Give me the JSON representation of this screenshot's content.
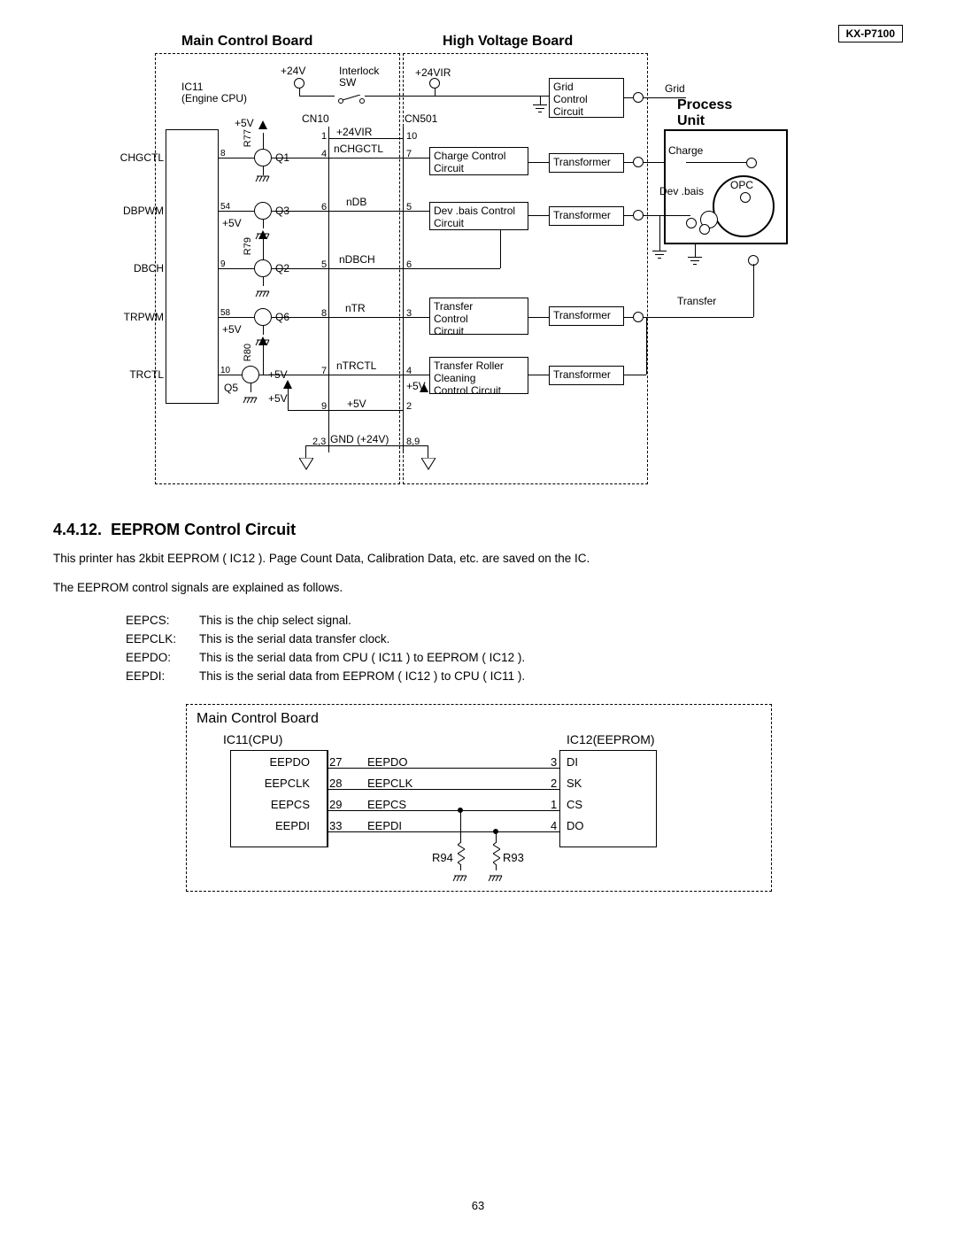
{
  "model": "KX-P7100",
  "diagram": {
    "mainTitle": "Main Control Board",
    "hvTitle": "High Voltage Board",
    "procTitle": "Process\nUnit",
    "ic": "IC11\n(Engine CPU)",
    "p5v_a": "+5V",
    "p5v_b": "+5V",
    "p5v_c": "+5V",
    "p5v_d": "+5V",
    "p5v_e": "+5V",
    "p5v_f": "+5V",
    "p24v": "+24V",
    "interlock": "Interlock\nSW",
    "p24vir": "+24VIR",
    "r77": "R77",
    "r79": "R79",
    "r80": "R80",
    "cn10": "CN10",
    "cn501": "CN501",
    "signals": {
      "CHGCTL": "CHGCTL",
      "DBPWM": "DBPWM",
      "DBCH": "DBCH",
      "TRPWM": "TRPWM",
      "TRCTL": "TRCTL"
    },
    "pinsL": {
      "CHGCTL": "8",
      "DBPWM": "54",
      "DBCH": "9",
      "TRPWM": "58",
      "TRCTL": "10"
    },
    "q": {
      "Q1": "Q1",
      "Q2": "Q2",
      "Q3": "Q3",
      "Q5": "Q5",
      "Q6": "Q6"
    },
    "netnames": {
      "p24vir_b": "+24VIR",
      "nCHGCTL": "nCHGCTL",
      "nDB": "nDB",
      "nDBCH": "nDBCH",
      "nTR": "nTR",
      "nTRCTL": "nTRCTL",
      "p5v_net": "+5V",
      "gnd24": "GND (+24V)"
    },
    "cn10pins": {
      "a": "1",
      "b": "4",
      "c": "6",
      "d": "5",
      "e": "8",
      "f": "7",
      "g": "9",
      "h": "2,3"
    },
    "cn501pins": {
      "a": "10",
      "b": "7",
      "c": "5",
      "d": "6",
      "e": "3",
      "f": "4",
      "g": "2",
      "h": "8,9"
    },
    "blocks": {
      "grid": "Grid\nControl\nCircuit",
      "charge": "Charge Control\nCircuit",
      "dev": "Dev .bais Control\nCircuit",
      "trf": "Transfer\nControl\nCircuit",
      "trRoller": "Transfer Roller\nCleaning\nControl Circuit",
      "xfmr": "Transformer"
    },
    "proc": {
      "grid": "Grid",
      "charge": "Charge",
      "devbais": "Dev .bais",
      "opc": "OPC",
      "transfer": "Transfer"
    }
  },
  "section": {
    "num": "4.4.12.",
    "title": "EEPROM Control Circuit",
    "intro": "This printer has 2kbit EEPROM ( IC12 ). Page Count Data, Calibration Data, etc. are saved on the IC.",
    "lead": "The EEPROM control signals are explained as follows.",
    "rows": [
      {
        "k": "EEPCS:",
        "v": "This is the chip select signal."
      },
      {
        "k": "EEPCLK:",
        "v": "This is the serial data transfer clock."
      },
      {
        "k": "EEPDO:",
        "v": "This is the serial data from CPU ( IC11 ) to EEPROM ( IC12 )."
      },
      {
        "k": "EEPDI:",
        "v": "This is the serial data from EEPROM ( IC12 ) to CPU ( IC11 )."
      }
    ]
  },
  "eeprom": {
    "board": "Main Control Board",
    "ic11": "IC11(CPU)",
    "ic12": "IC12(EEPROM)",
    "left": [
      {
        "name": "EEPDO",
        "pin": "27"
      },
      {
        "name": "EEPCLK",
        "pin": "28"
      },
      {
        "name": "EEPCS",
        "pin": "29"
      },
      {
        "name": "EEPDI",
        "pin": "33"
      }
    ],
    "nets": [
      "EEPDO",
      "EEPCLK",
      "EEPCS",
      "EEPDI"
    ],
    "right": [
      {
        "pin": "3",
        "name": "DI"
      },
      {
        "pin": "2",
        "name": "SK"
      },
      {
        "pin": "1",
        "name": "CS"
      },
      {
        "pin": "4",
        "name": "DO"
      }
    ],
    "r94": "R94",
    "r93": "R93"
  },
  "pageNumber": "63"
}
